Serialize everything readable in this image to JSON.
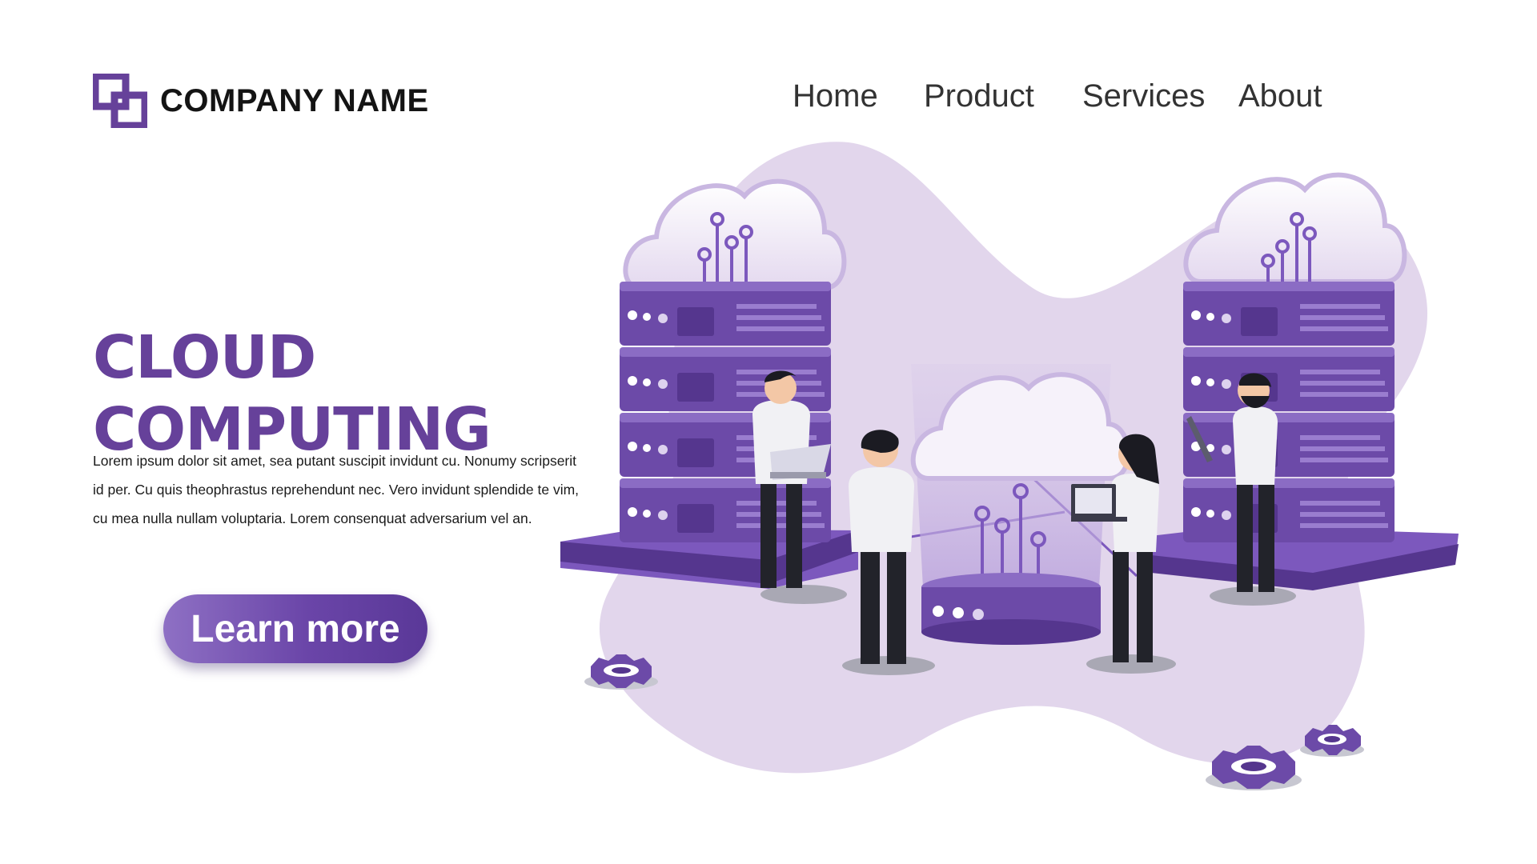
{
  "brand": {
    "name": "COMPANY NAME",
    "accent": "#66419a",
    "logo_icon": "overlapping-squares-logo"
  },
  "nav": {
    "items": [
      {
        "label": "Home"
      },
      {
        "label": "Product"
      },
      {
        "label": "Services"
      },
      {
        "label": "About"
      }
    ]
  },
  "hero": {
    "title_line1": "CLOUD",
    "title_line2": "COMPUTING",
    "body": "Lorem ipsum dolor sit amet, sea putant suscipit invidunt cu. Nonumy scripserit id per. Cu quis theophrastus reprehendunt nec. Vero invidunt splendide te vim, cu mea nulla nullam voluptaria. Lorem consenquat adversarium vel an.",
    "cta_label": "Learn more"
  },
  "illustration": {
    "icons": [
      "cloud-icon",
      "server-rack-icon",
      "gear-icon",
      "person-with-laptop-icon"
    ],
    "colors": {
      "blob": "#e2d6ec",
      "server": "#6c4aa8",
      "server_dark": "#523388",
      "server_light": "#8b6cc4",
      "cloud": "#f3eef8"
    }
  }
}
